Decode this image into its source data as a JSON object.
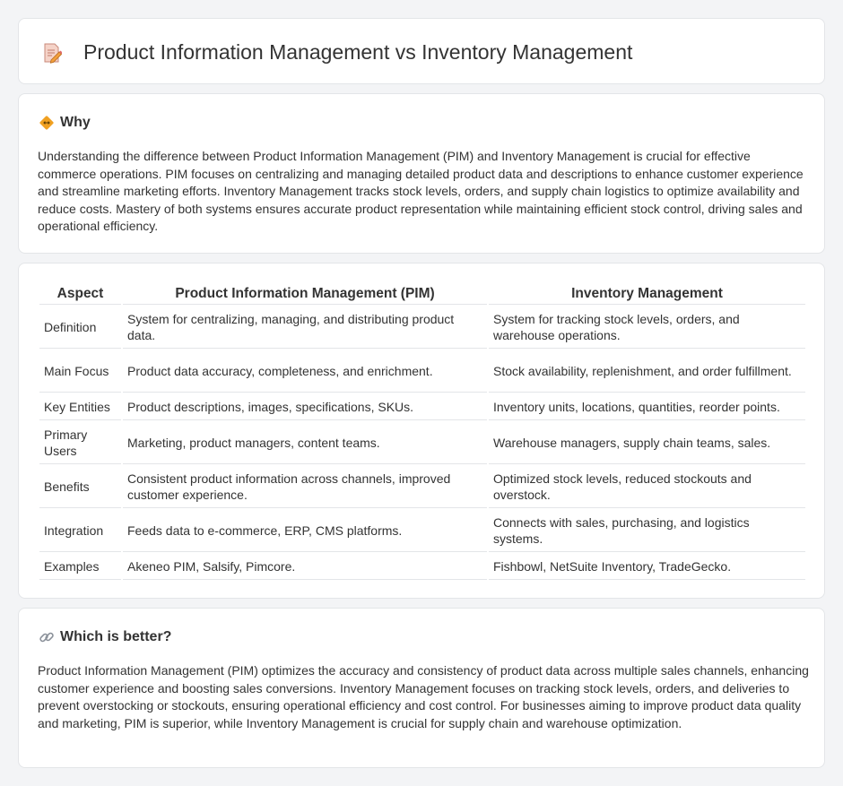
{
  "header": {
    "title": "Product Information Management vs Inventory Management",
    "icon": "document-pencil-icon"
  },
  "why": {
    "title": "Why",
    "icon": "diamond-arrows-icon",
    "text": "Understanding the difference between Product Information Management (PIM) and Inventory Management is crucial for effective commerce operations. PIM focuses on centralizing and managing detailed product data and descriptions to enhance customer experience and streamline marketing efforts. Inventory Management tracks stock levels, orders, and supply chain logistics to optimize availability and reduce costs. Mastery of both systems ensures accurate product representation while maintaining efficient stock control, driving sales and operational efficiency."
  },
  "table": {
    "headers": [
      "Aspect",
      "Product Information Management (PIM)",
      "Inventory Management"
    ],
    "rows": [
      [
        "Definition",
        "System for centralizing, managing, and distributing product data.",
        "System for tracking stock levels, orders, and warehouse operations."
      ],
      [
        "Main Focus",
        "Product data accuracy, completeness, and enrichment.",
        "Stock availability, replenishment, and order fulfillment."
      ],
      [
        "Key Entities",
        "Product descriptions, images, specifications, SKUs.",
        "Inventory units, locations, quantities, reorder points."
      ],
      [
        "Primary Users",
        "Marketing, product managers, content teams.",
        "Warehouse managers, supply chain teams, sales."
      ],
      [
        "Benefits",
        "Consistent product information across channels, improved customer experience.",
        "Optimized stock levels, reduced stockouts and overstock."
      ],
      [
        "Integration",
        "Feeds data to e-commerce, ERP, CMS platforms.",
        "Connects with sales, purchasing, and logistics systems."
      ],
      [
        "Examples",
        "Akeneo PIM, Salsify, Pimcore.",
        "Fishbowl, NetSuite Inventory, TradeGecko."
      ]
    ]
  },
  "better": {
    "title": "Which is better?",
    "icon": "link-icon",
    "text": "Product Information Management (PIM) optimizes the accuracy and consistency of product data across multiple sales channels, enhancing customer experience and boosting sales conversions. Inventory Management focuses on tracking stock levels, orders, and deliveries to prevent overstocking or stockouts, ensuring operational efficiency and cost control. For businesses aiming to improve product data quality and marketing, PIM is superior, while Inventory Management is crucial for supply chain and warehouse optimization."
  },
  "colors": {
    "background": "#f3f4f6",
    "card": "#ffffff",
    "border": "#e3e5e8",
    "text": "#333333",
    "icon_orange": "#f0a020",
    "icon_pink": "#e06a6a"
  }
}
